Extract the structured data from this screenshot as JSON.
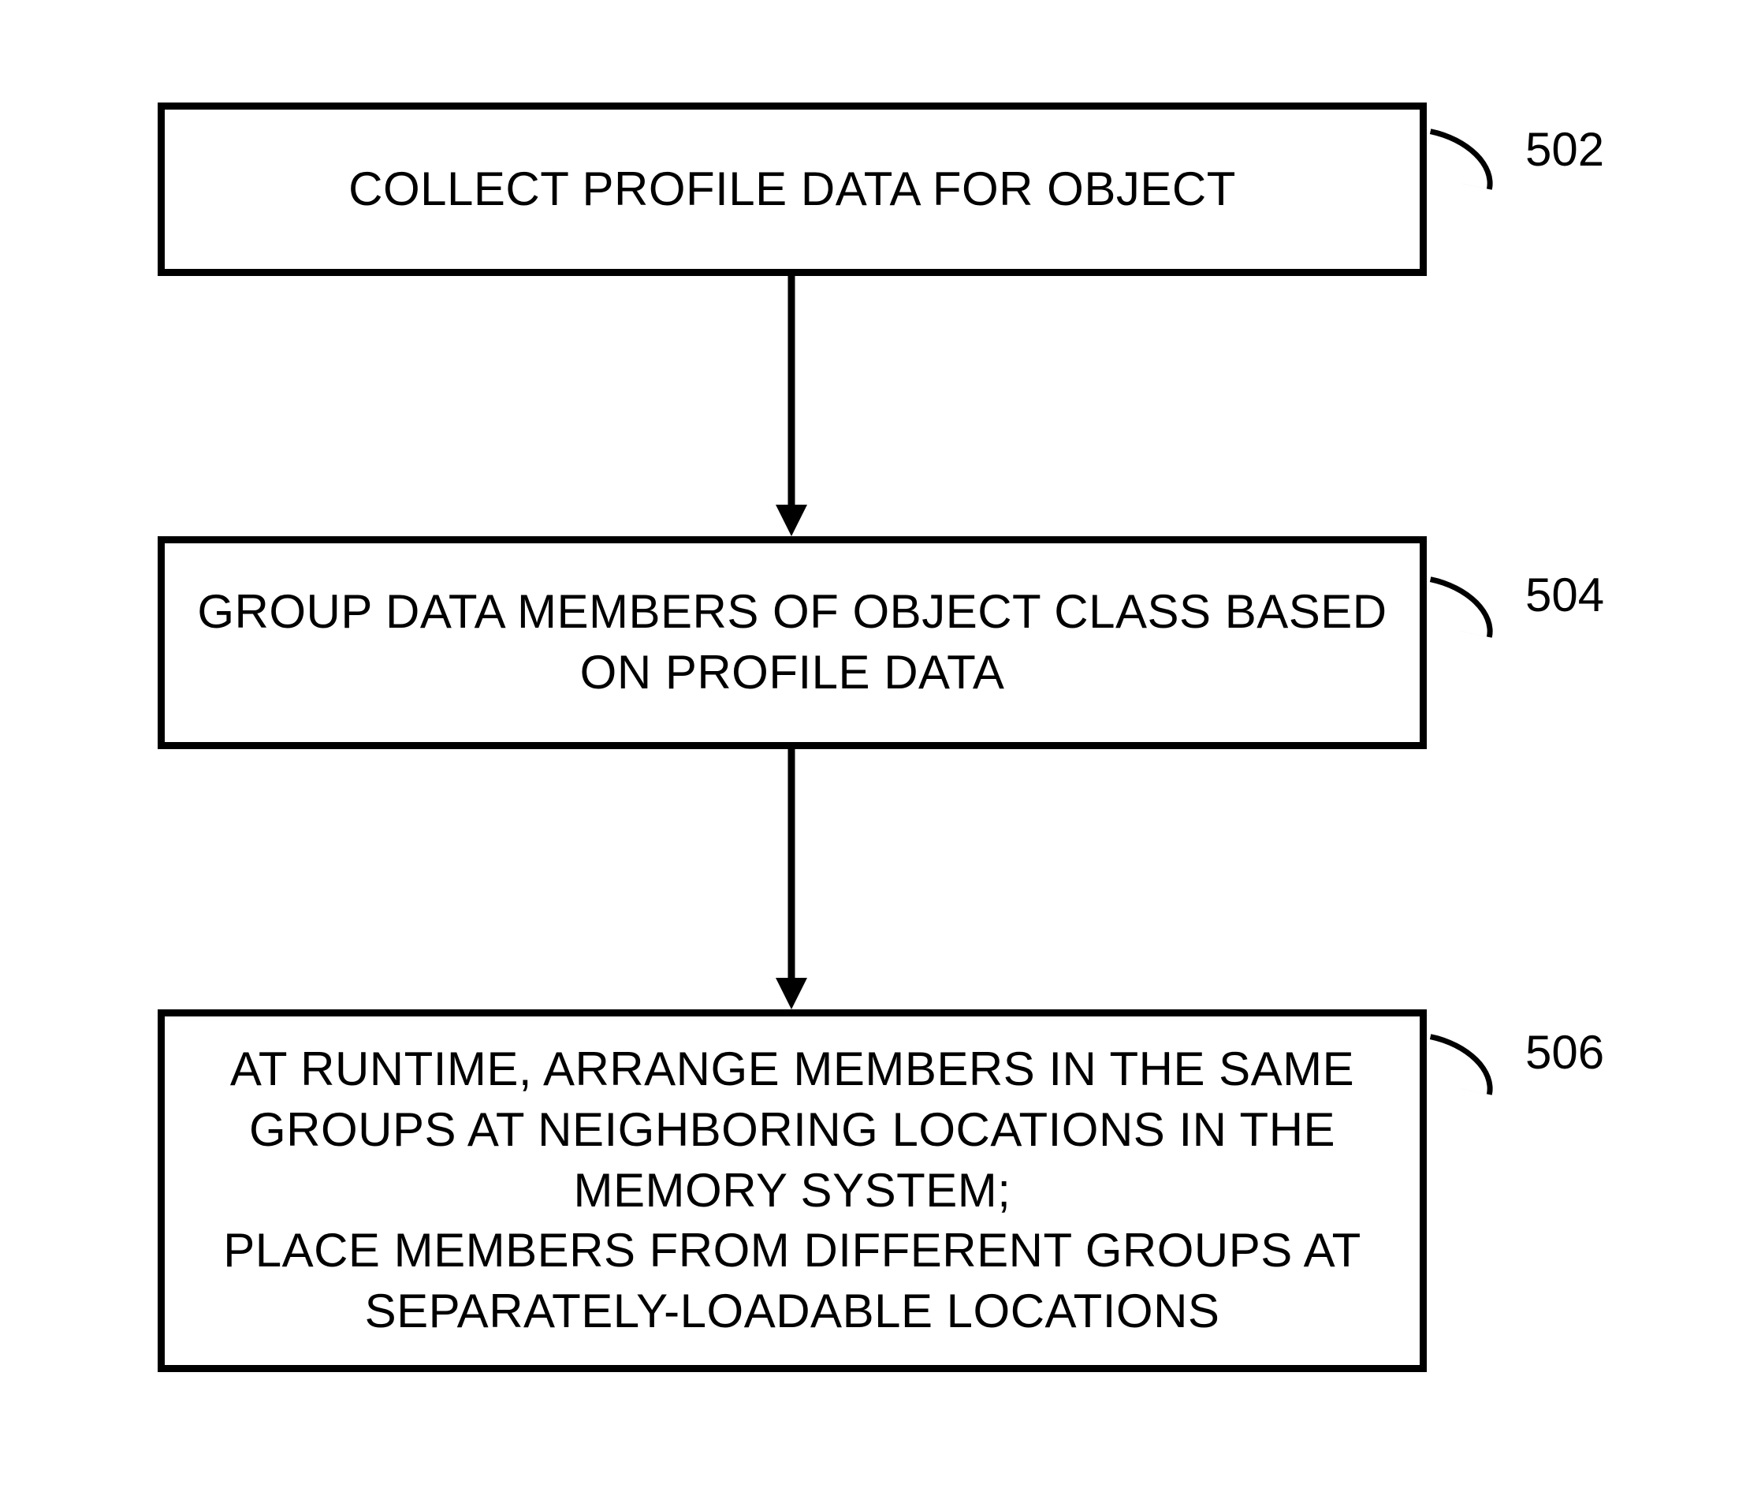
{
  "boxes": {
    "b1": {
      "label": "502",
      "text": "COLLECT PROFILE DATA FOR OBJECT"
    },
    "b2": {
      "label": "504",
      "text": "GROUP DATA MEMBERS OF OBJECT CLASS BASED\nON PROFILE DATA"
    },
    "b3": {
      "label": "506",
      "text": "AT RUNTIME, ARRANGE MEMBERS IN THE SAME\nGROUPS AT NEIGHBORING LOCATIONS IN THE\nMEMORY SYSTEM;\nPLACE MEMBERS FROM DIFFERENT GROUPS AT\nSEPARATELY-LOADABLE LOCATIONS"
    }
  }
}
